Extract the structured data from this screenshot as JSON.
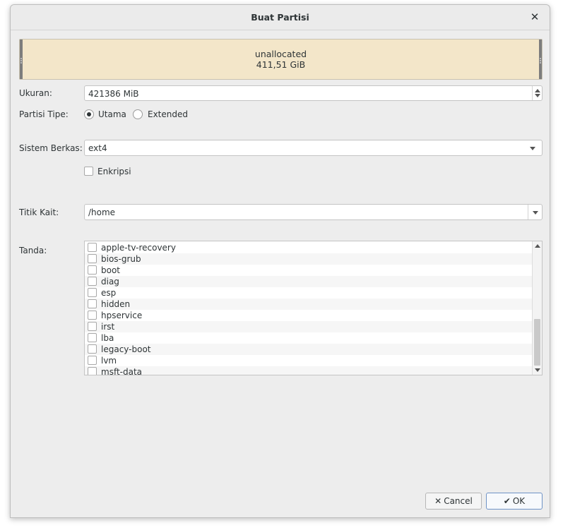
{
  "window": {
    "title": "Buat Partisi",
    "close_glyph": "✕"
  },
  "disk": {
    "label": "unallocated",
    "size": "411,51 GiB"
  },
  "size_field": {
    "label": "Ukuran:",
    "value": "421386 MiB"
  },
  "partition_type": {
    "label": "Partisi Tipe:",
    "options": [
      "Utama",
      "Extended"
    ],
    "selected": "Utama"
  },
  "filesystem": {
    "label": "Sistem Berkas:",
    "value": "ext4"
  },
  "encrypt": {
    "label": "Enkripsi",
    "checked": false
  },
  "mount_point": {
    "label": "Titik Kait:",
    "value": "/home"
  },
  "flags": {
    "label": "Tanda:",
    "items": [
      "apple-tv-recovery",
      "bios-grub",
      "boot",
      "diag",
      "esp",
      "hidden",
      "hpservice",
      "irst",
      "lba",
      "legacy-boot",
      "lvm",
      "msft-data"
    ]
  },
  "buttons": {
    "cancel": "Cancel",
    "ok": "OK",
    "cancel_icon": "✕",
    "ok_icon": "✔"
  }
}
